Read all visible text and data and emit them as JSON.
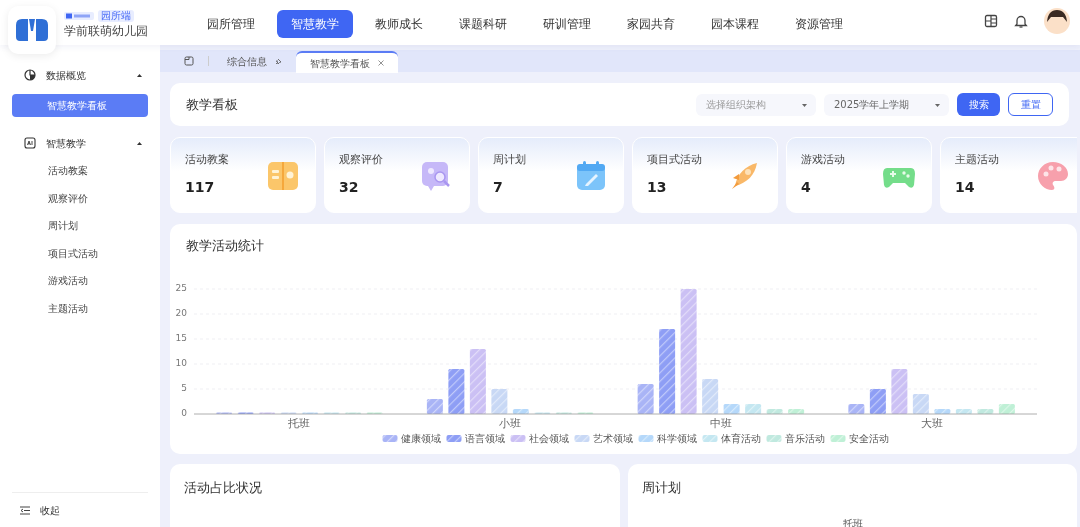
{
  "brand": {
    "badge": "园所端",
    "name": "学前联萌幼儿园"
  },
  "top_nav": [
    {
      "label": "园所管理",
      "selected": false
    },
    {
      "label": "智慧教学",
      "selected": true
    },
    {
      "label": "教师成长",
      "selected": false
    },
    {
      "label": "课题科研",
      "selected": false
    },
    {
      "label": "研训管理",
      "selected": false
    },
    {
      "label": "家园共育",
      "selected": false
    },
    {
      "label": "园本课程",
      "selected": false
    },
    {
      "label": "资源管理",
      "selected": false
    }
  ],
  "sidebar": {
    "groups": [
      {
        "label": "数据概览",
        "expanded": true,
        "children": [
          {
            "label": "智慧教学看板",
            "selected": true
          }
        ]
      },
      {
        "label": "智慧教学",
        "expanded": true,
        "children": [
          {
            "label": "活动教案",
            "selected": false
          },
          {
            "label": "观察评价",
            "selected": false
          },
          {
            "label": "周计划",
            "selected": false
          },
          {
            "label": "项目式活动",
            "selected": false
          },
          {
            "label": "游戏活动",
            "selected": false
          },
          {
            "label": "主题活动",
            "selected": false
          }
        ]
      }
    ],
    "collapse": "收起"
  },
  "tabs": [
    {
      "label": "综合信息",
      "selected": false,
      "kind": "pinned"
    },
    {
      "label": "智慧教学看板",
      "selected": true,
      "kind": "closable"
    }
  ],
  "filter": {
    "title": "教学看板",
    "org": {
      "placeholder": "选择组织架构"
    },
    "term": {
      "value": "2025学年上学期"
    },
    "buttons": [
      {
        "label": "搜索",
        "kind": "primary"
      },
      {
        "label": "重置",
        "kind": "outline"
      }
    ]
  },
  "stats": [
    {
      "label": "活动教案",
      "value": "117"
    },
    {
      "label": "观察评价",
      "value": "32"
    },
    {
      "label": "周计划",
      "value": "7"
    },
    {
      "label": "项目式活动",
      "value": "13"
    },
    {
      "label": "游戏活动",
      "value": "4"
    },
    {
      "label": "主题活动",
      "value": "14"
    }
  ],
  "activity_chart": {
    "chart_data": {
      "type": "bar",
      "title": "教学活动统计",
      "grid": true,
      "legend": true,
      "categories": [
        "托班",
        "小班",
        "中班",
        "大班"
      ],
      "ylim": [
        0,
        25
      ],
      "yticks": [
        0,
        5,
        10,
        15,
        20,
        25
      ],
      "series": [
        {
          "name": "健康领域",
          "color": "#a9b4f6",
          "values": [
            0,
            3,
            6,
            2
          ]
        },
        {
          "name": "语言领域",
          "color": "#8e9ef5",
          "values": [
            0,
            9,
            17,
            5
          ]
        },
        {
          "name": "社会领域",
          "color": "#cbc0f4",
          "values": [
            0,
            13,
            25,
            9
          ]
        },
        {
          "name": "艺术领域",
          "color": "#c8d8f5",
          "values": [
            0,
            5,
            7,
            4
          ]
        },
        {
          "name": "科学领域",
          "color": "#b5d8fa",
          "values": [
            0,
            1,
            2,
            1
          ]
        },
        {
          "name": "体育活动",
          "color": "#c4e7f1",
          "values": [
            0,
            0,
            2,
            1
          ]
        },
        {
          "name": "音乐活动",
          "color": "#c0e9df",
          "values": [
            0,
            0,
            1,
            1
          ]
        },
        {
          "name": "安全活动",
          "color": "#bff0d6",
          "values": [
            0,
            0,
            1,
            2
          ]
        }
      ]
    }
  },
  "bottom_cards": [
    {
      "title": "活动占比状况"
    },
    {
      "title": "周计划",
      "caption": "托班"
    }
  ]
}
